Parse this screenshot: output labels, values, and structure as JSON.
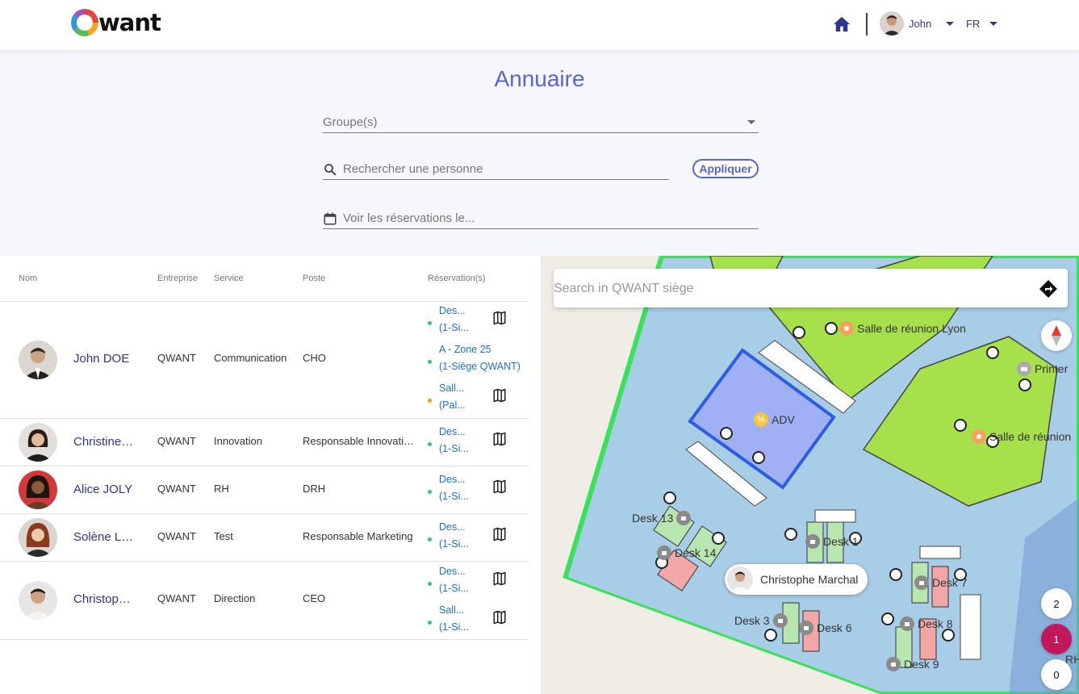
{
  "header": {
    "logo_text": "want",
    "user_name": "John",
    "language": "FR"
  },
  "page": {
    "title": "Annuaire"
  },
  "filters": {
    "groups_placeholder": "Groupe(s)",
    "search_placeholder": "Rechercher une personne",
    "apply_label": "Appliquer",
    "date_placeholder": "Voir les réservations le..."
  },
  "table": {
    "headers": {
      "name": "Nom",
      "company": "Entreprise",
      "service": "Service",
      "position": "Poste",
      "reservations": "Réservation(s)"
    },
    "rows": [
      {
        "name": "John DOE",
        "company": "QWANT",
        "service": "Communication",
        "position": "CHO",
        "reservations": [
          {
            "line1": "Des...",
            "line2": "(1-Si...",
            "status": "green"
          },
          {
            "line1": "A - Zone 25",
            "line2": "(1-Siège QWANT)",
            "status": "green"
          },
          {
            "line1": "Sall...",
            "line2": "(Pal...",
            "status": "orange"
          }
        ]
      },
      {
        "name": "Christine…",
        "company": "QWANT",
        "service": "Innovation",
        "position": "Responsable Innovati…",
        "reservations": [
          {
            "line1": "Des...",
            "line2": "(1-Si...",
            "status": "green"
          }
        ]
      },
      {
        "name": "Alice JOLY",
        "company": "QWANT",
        "service": "RH",
        "position": "DRH",
        "reservations": [
          {
            "line1": "Des...",
            "line2": "(1-Si...",
            "status": "green"
          }
        ]
      },
      {
        "name": "Solène L…",
        "company": "QWANT",
        "service": "Test",
        "position": "Responsable Marketing",
        "reservations": [
          {
            "line1": "Des...",
            "line2": "(1-Si...",
            "status": "green"
          }
        ]
      },
      {
        "name": "Christop…",
        "company": "QWANT",
        "service": "Direction",
        "position": "CEO",
        "reservations": [
          {
            "line1": "Des...",
            "line2": "(1-Si...",
            "status": "green"
          },
          {
            "line1": "Sall...",
            "line2": "(1-Si...",
            "status": "green"
          }
        ]
      }
    ]
  },
  "map": {
    "search_placeholder": "Search in QWANT siège",
    "labels": {
      "lyon": "Salle de réunion Lyon",
      "printer": "Printer",
      "adv": "ADV",
      "salle2": "Salle de réunion",
      "desk13": "Desk 13",
      "desk14": "Desk 14",
      "desk1": "Desk 1",
      "desk7": "Desk 7",
      "desk3": "Desk 3",
      "desk6": "Desk 6",
      "desk8": "Desk 8",
      "desk9": "Desk 9",
      "rh": "RH"
    },
    "tooltip_name": "Christophe Marchal",
    "floors": [
      "2",
      "1",
      "0"
    ],
    "active_floor": "1"
  },
  "colors": {
    "accent": "#5a63d6",
    "navy": "#2d3590",
    "link": "#1a6fd1",
    "status_green": "#2ecc71",
    "status_orange": "#f39c12",
    "active_floor": "#c2185b"
  }
}
